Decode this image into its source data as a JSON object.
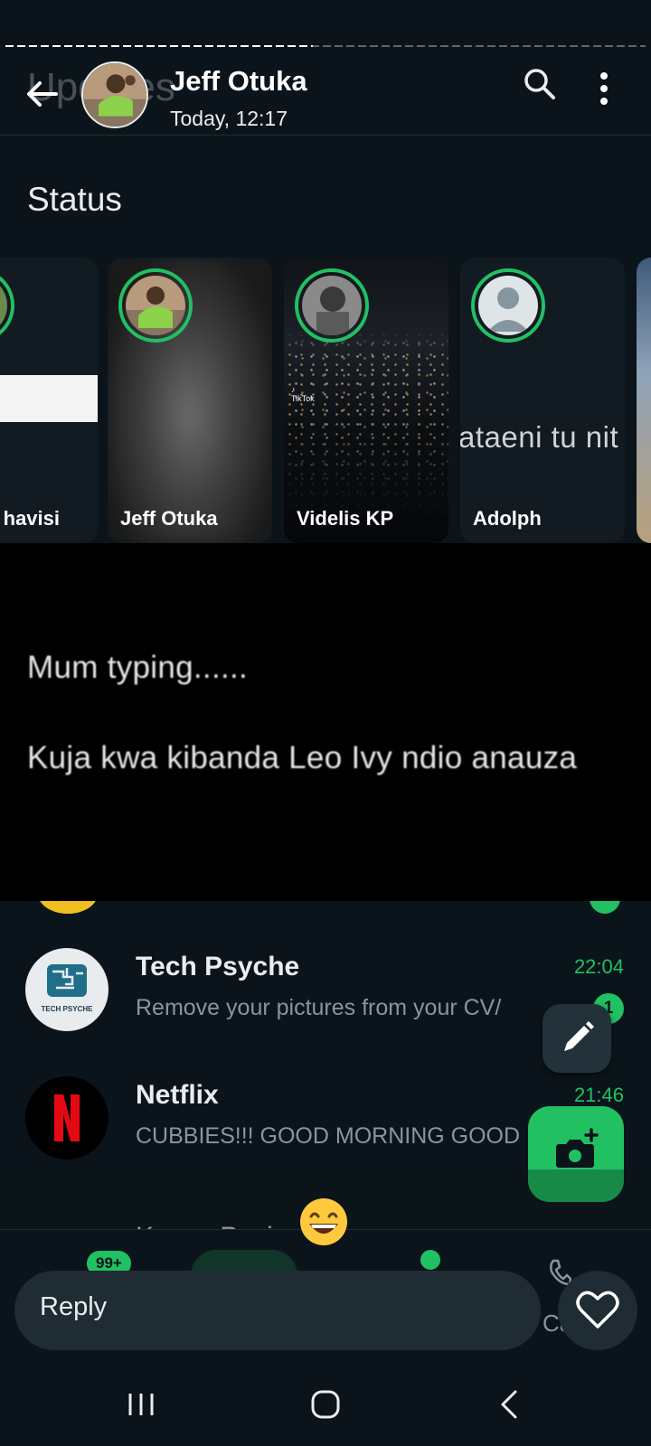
{
  "progress": {
    "fraction": 0.48
  },
  "header": {
    "ghost_title": "Updates",
    "contact_name": "Jeff Otuka",
    "timestamp": "Today, 12:17"
  },
  "status_section": {
    "heading": "Status",
    "cards": [
      {
        "name": "havisi"
      },
      {
        "name": "Jeff Otuka"
      },
      {
        "name": "Videlis KP"
      },
      {
        "name": "Adolph",
        "overlay_text": "ataeni tu nit"
      }
    ]
  },
  "status_text": {
    "line1": "Mum typing......",
    "line2": "Kuja kwa kibanda Leo Ivy ndio anauza"
  },
  "chats": [
    {
      "title": "Tech Psyche",
      "preview": "Remove your pictures from your CV/",
      "time": "22:04",
      "unread": "1"
    },
    {
      "title": "Netflix",
      "preview": "CUBBIES!!! GOOD MORNING GOOD",
      "time": "21:46"
    }
  ],
  "peek_row": {
    "title": "Kenya Pasi..."
  },
  "bottom_nav": {
    "chats_badge": "99+",
    "calls_label": "Ca"
  },
  "reply": {
    "placeholder": "Reply"
  },
  "colors": {
    "accent": "#21c063",
    "background": "#0b141a",
    "surface": "#1f2c33"
  }
}
